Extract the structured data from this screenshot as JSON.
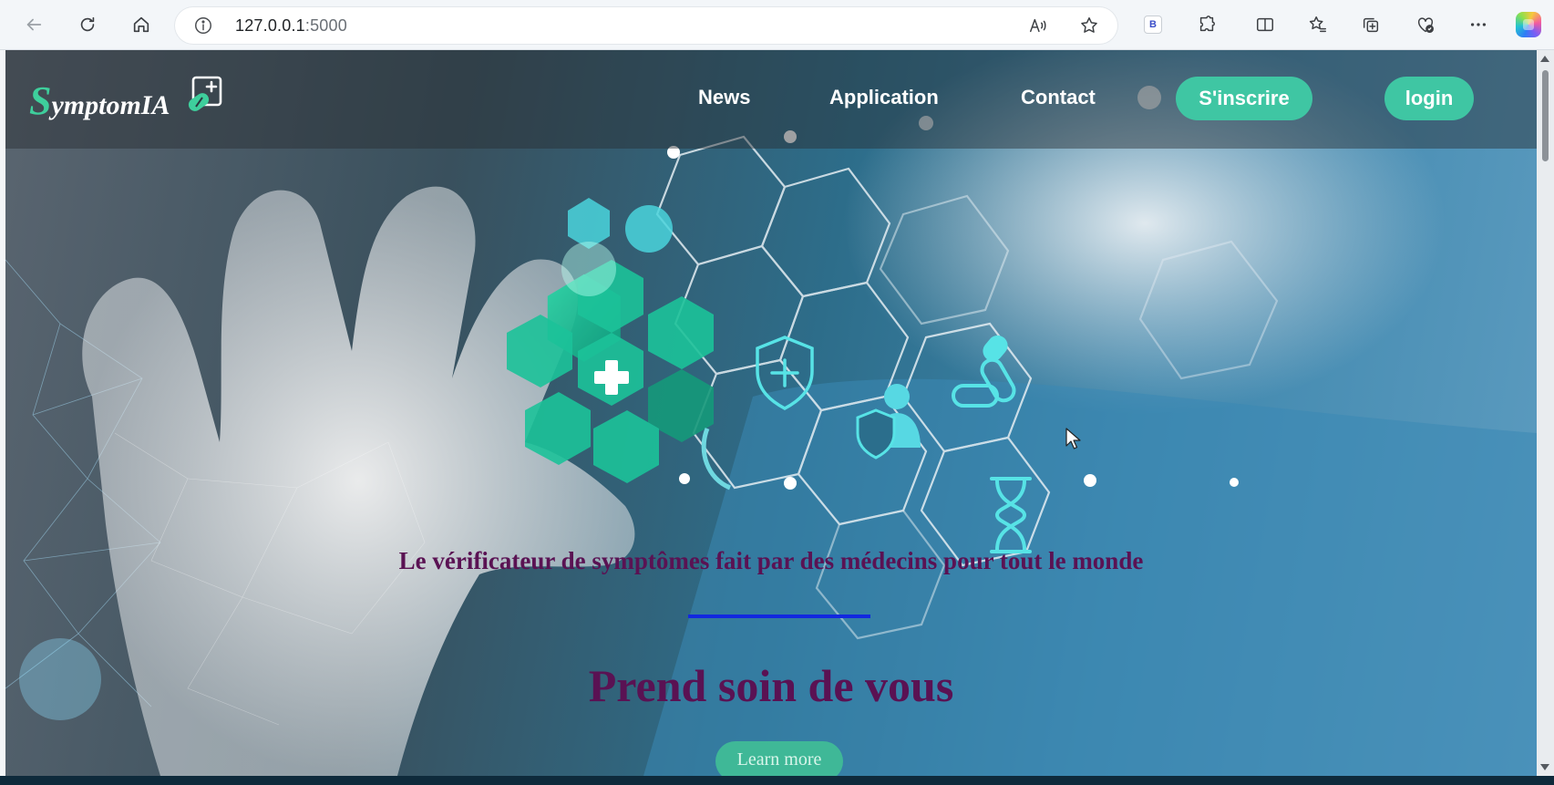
{
  "browser": {
    "url_host": "127.0.0.1",
    "url_port": ":5000",
    "extension_badge": "B"
  },
  "site": {
    "logo_initial": "S",
    "logo_rest": "ymptomIA",
    "nav": {
      "news": "News",
      "application": "Application",
      "contact": "Contact"
    },
    "buttons": {
      "signup": "S'inscrire",
      "login": "login"
    }
  },
  "hero": {
    "tagline": "Le vérificateur de symptômes fait par des médecins pour tout le monde",
    "headline": "Prend soin de vous",
    "cta": "Learn more"
  },
  "icons": {
    "back": "back-arrow-icon",
    "refresh": "refresh-icon",
    "home": "home-icon",
    "site_info": "info-icon",
    "read_aloud": "read-aloud-icon",
    "favorite": "star-icon",
    "extensions": "puzzle-icon",
    "split_screen": "split-screen-icon",
    "favorites_bar": "favorites-icon",
    "collections": "collections-icon",
    "browser_essentials": "heart-pulse-icon",
    "more": "more-icon",
    "copilot": "copilot-icon"
  },
  "colors": {
    "accent_green": "#3fc6a3",
    "text_purple": "#5a1253",
    "divider_blue": "#1228e0"
  }
}
